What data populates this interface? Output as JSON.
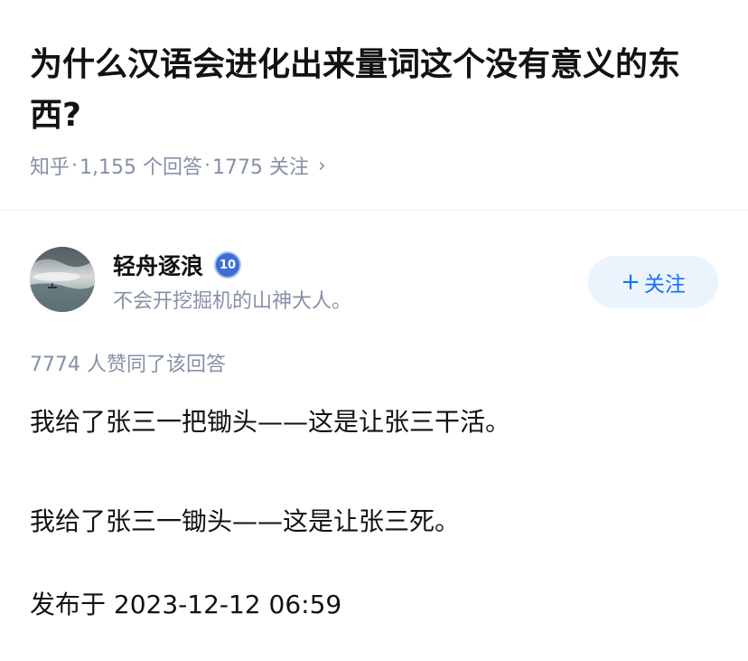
{
  "question": {
    "title": "为什么汉语会进化出来量词这个没有意义的东西?",
    "source": "知乎",
    "answers_count": "1,155 个回答",
    "followers_count": "1775 关注",
    "separator": "·",
    "more_icon": "chevron-right-icon"
  },
  "author": {
    "name": "轻舟逐浪",
    "level_badge": "10",
    "bio": "不会开挖掘机的山神大人。",
    "follow_label": "关注",
    "follow_icon": "plus-icon",
    "colors": {
      "follow_text": "#1772f6",
      "follow_bg": "#ebf3fd",
      "badge": "#3c6fd6"
    }
  },
  "answer": {
    "votes": "7774 人赞同了该回答",
    "paragraphs": [
      "我给了张三一把锄头——这是让张三干活。",
      "我给了张三一锄头——这是让张三死。"
    ],
    "published": "发布于 2023-12-12 06:59"
  }
}
